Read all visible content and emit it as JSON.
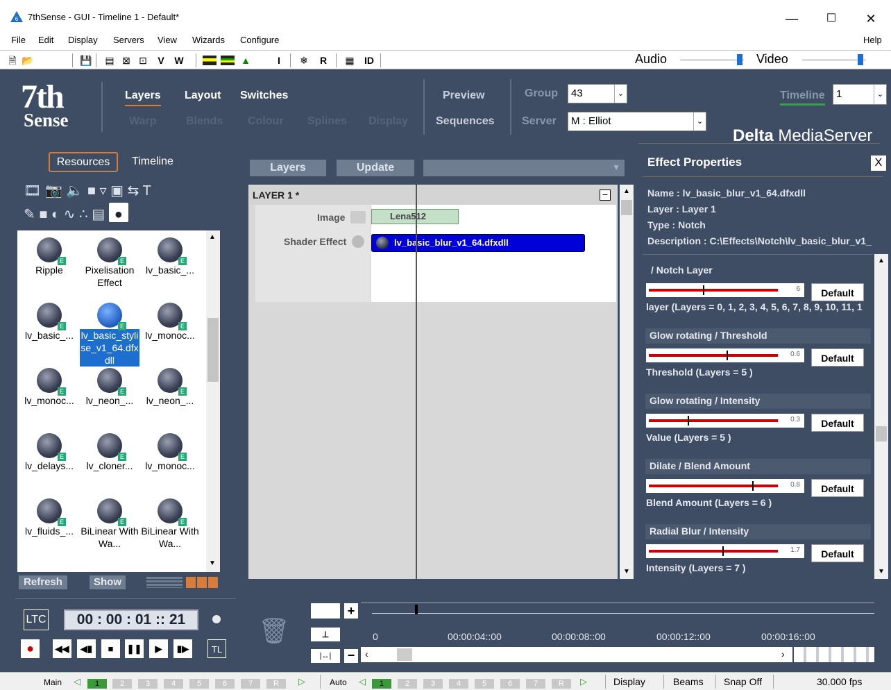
{
  "window": {
    "title": "7thSense - GUI - Timeline 1 - Default*"
  },
  "menu": [
    "File",
    "Edit",
    "Display",
    "Servers",
    "View",
    "Wizards",
    "Configure",
    "Help"
  ],
  "toolbar": {
    "buttons": [
      "V",
      "W",
      "I",
      "R",
      "ID"
    ],
    "audio_label": "Audio",
    "video_label": "Video"
  },
  "nav": {
    "logo_top": "7th",
    "logo_bottom": "Sense",
    "row1": [
      "Layers",
      "Layout",
      "Switches"
    ],
    "row2": [
      "Warp",
      "Blends",
      "Colour",
      "Splines",
      "Display"
    ],
    "preview": "Preview",
    "sequences": "Sequences",
    "group_label": "Group",
    "group_value": "43",
    "server_label": "Server",
    "server_value": "M : Elliot",
    "timeline_label": "Timeline",
    "timeline_value": "1",
    "brand_bold": "Delta",
    "brand_rest": " MediaServer"
  },
  "left": {
    "tab_resources": "Resources",
    "tab_timeline": "Timeline",
    "resources": [
      [
        "Ripple",
        "Pixelisation Effect",
        "lv_basic_..."
      ],
      [
        "lv_basic_...",
        "lv_basic_stylise_v1_64.dfxdll",
        "lv_monoc..."
      ],
      [
        "lv_monoc...",
        "lv_neon_...",
        "lv_neon_..."
      ],
      [
        "lv_delays...",
        "lv_cloner...",
        "lv_monoc..."
      ],
      [
        "lv_fluids_...",
        "BiLinear With Wa...",
        "BiLinear With Wa..."
      ]
    ],
    "refresh": "Refresh",
    "show": "Show",
    "ltc": "LTC",
    "timecode": "00 : 00 : 01 :: 21",
    "tl": "TL"
  },
  "center": {
    "btn_layers": "Layers",
    "btn_update": "Update",
    "layer_title": "LAYER 1 *",
    "image_label": "Image",
    "image_value": "Lena512",
    "shader_label": "Shader Effect",
    "shader_value": "lv_basic_blur_v1_64.dfxdll",
    "timeline_ticks": [
      "0",
      "00:00:04::00",
      "00:00:08::00",
      "00:00:12::00",
      "00:00:16::00"
    ]
  },
  "props": {
    "title": "Effect Properties",
    "close": "X",
    "name": "Name : lv_basic_blur_v1_64.dfxdll",
    "layer": "Layer : Layer 1",
    "type": "Type : Notch",
    "description": "Description : C:\\Effects\\Notch\\lv_basic_blur_v1_",
    "default_label": "Default",
    "sections": [
      {
        "head": "/ Notch Layer",
        "value": "6",
        "note": "layer (Layers = 0, 1, 2, 3, 4, 5, 6, 7, 8, 9, 10, 11, 1",
        "level": 0.42
      },
      {
        "head": "Glow rotating / Threshold",
        "value": "0.6",
        "note": "Threshold (Layers = 5 )",
        "level": 0.6
      },
      {
        "head": "Glow rotating / Intensity",
        "value": "0.3",
        "note": "Value (Layers = 5 )",
        "level": 0.3
      },
      {
        "head": "Dilate / Blend Amount",
        "value": "0.8",
        "note": "Blend Amount (Layers = 6 )",
        "level": 0.8
      },
      {
        "head": "Radial Blur / Intensity",
        "value": "1.7",
        "note": "Intensity (Layers = 7 )",
        "level": 0.57
      }
    ]
  },
  "status": {
    "main": "Main",
    "auto": "Auto",
    "pages": [
      "1",
      "2",
      "3",
      "4",
      "5",
      "6",
      "7",
      "R"
    ],
    "display": "Display",
    "beams": "Beams",
    "snap": "Snap Off",
    "fps": "30.000 fps"
  }
}
